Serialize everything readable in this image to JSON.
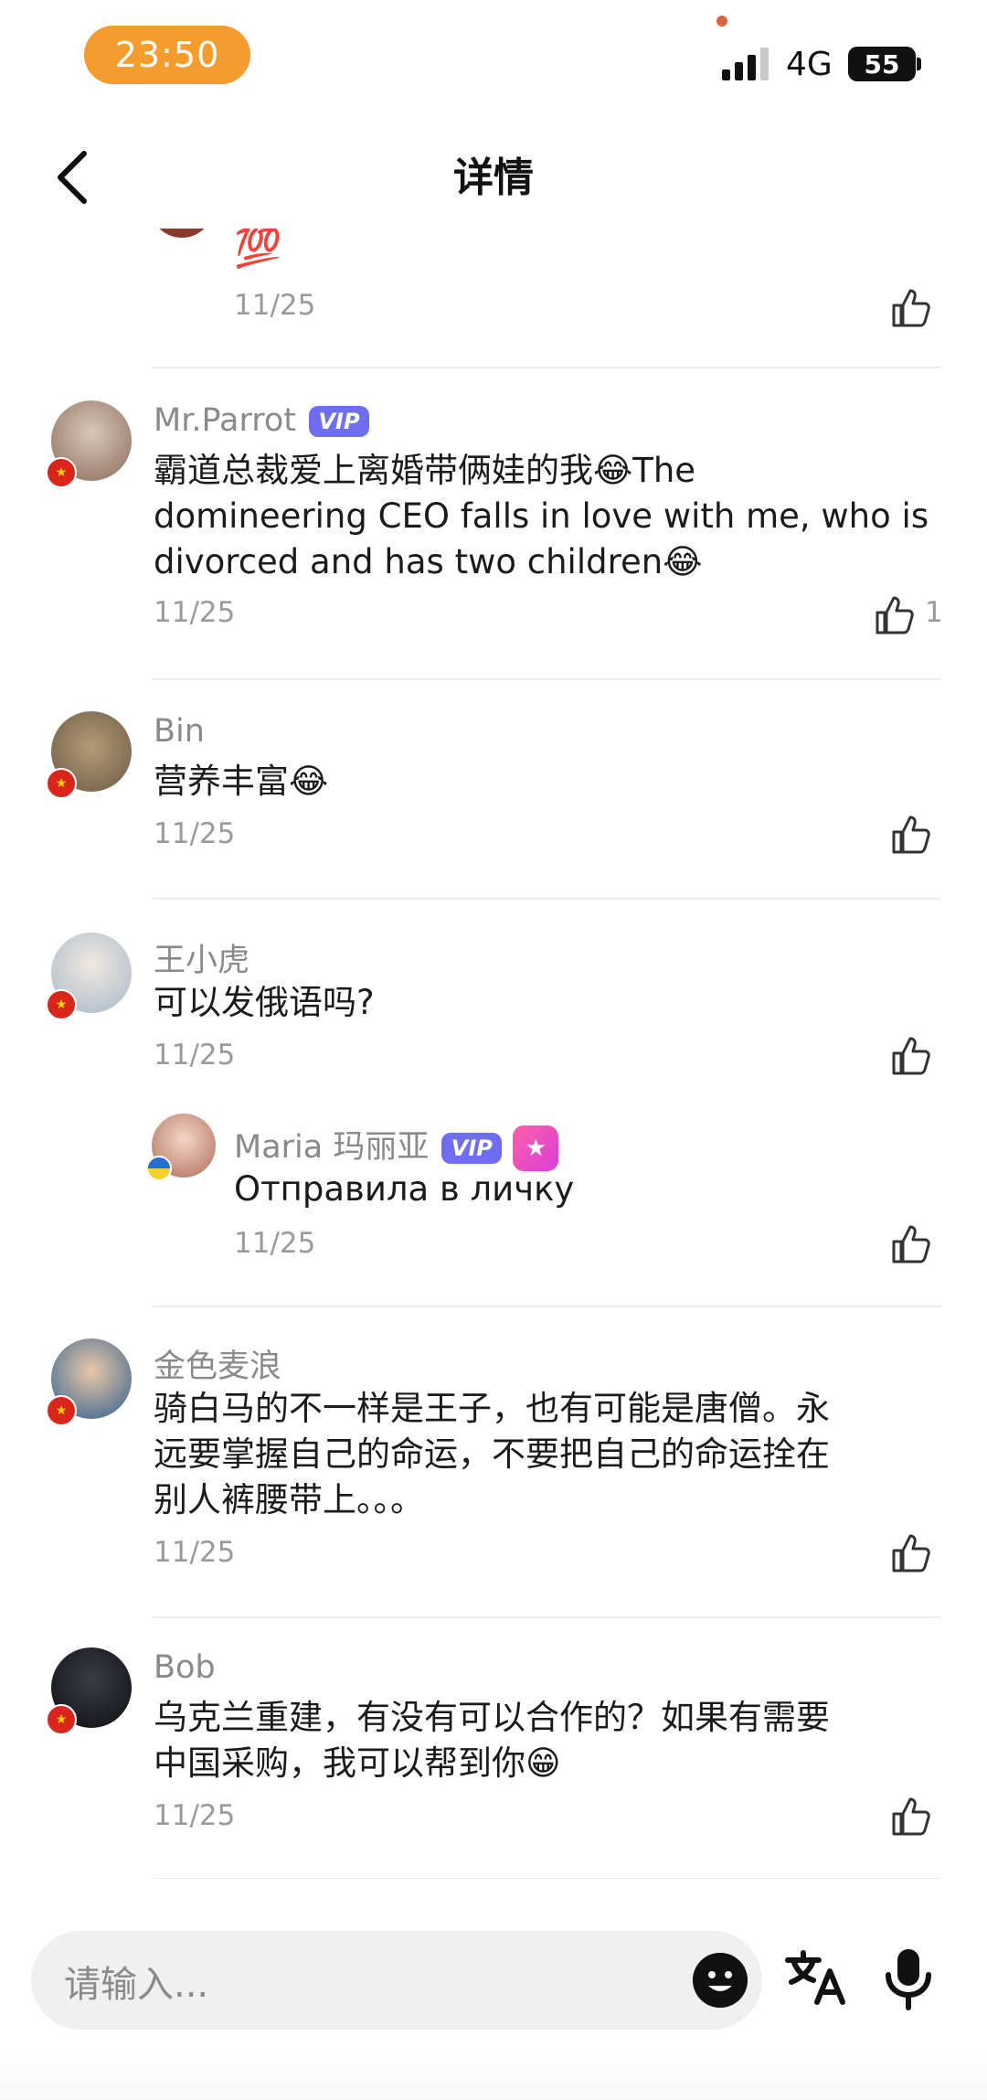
{
  "status_bar": {
    "time": "23:50",
    "network": "4G",
    "battery": "55"
  },
  "header": {
    "title": "详情"
  },
  "comments": [
    {
      "name": "",
      "text": "💯",
      "date": "11/25",
      "likes": ""
    },
    {
      "name": "Mr.Parrot",
      "badge": "VIP",
      "text_lines": [
        "霸道总裁爱上离婚带俩娃的我😂The",
        "domineering CEO falls in love with me, who is",
        "divorced and has two children😂"
      ],
      "date": "11/25",
      "likes": "1"
    },
    {
      "name": "Bin",
      "text": "营养丰富😂",
      "date": "11/25",
      "likes": ""
    },
    {
      "name": "王小虎",
      "text": "可以发俄语吗?",
      "date": "11/25",
      "likes": ""
    },
    {
      "name": "Maria 玛丽亚",
      "badge": "VIP",
      "text": "Отправила в личку",
      "date": "11/25",
      "likes": ""
    },
    {
      "name": "金色麦浪",
      "text_lines": [
        "骑白马的不一样是王子，也有可能是唐僧。永",
        "远要掌握自己的命运，不要把自己的命运拴在",
        "别人裤腰带上。。。"
      ],
      "date": "11/25",
      "likes": ""
    },
    {
      "name": "Bob",
      "text_lines": [
        "乌克兰重建，有没有可以合作的？如果有需要",
        "中国采购，我可以帮到你😁"
      ],
      "date": "11/25",
      "likes": ""
    }
  ],
  "input": {
    "placeholder": "请输入..."
  },
  "icons": {
    "back": "chevron-left-icon",
    "like": "thumbs-up-icon",
    "emoji": "smile-icon",
    "translate": "translate-icon",
    "mic": "microphone-icon"
  }
}
